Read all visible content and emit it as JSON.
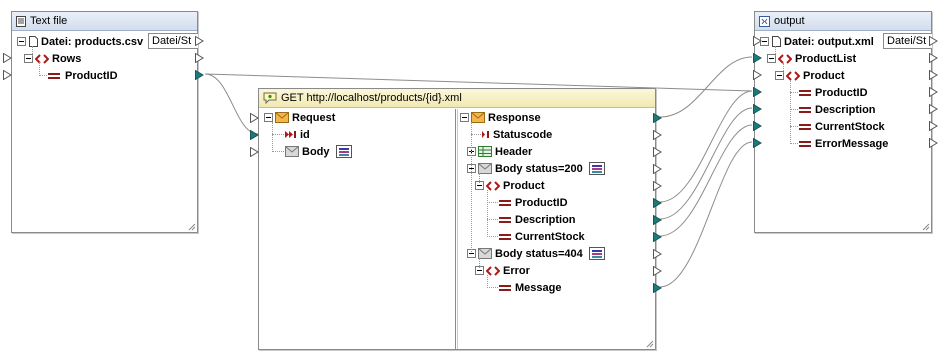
{
  "textfile": {
    "title": "Text file",
    "file_label": "Datei: products.csv",
    "dropdown": "Datei/St",
    "rows_label": "Rows",
    "productid_label": "ProductID"
  },
  "rest": {
    "title": "GET http://localhost/products/{id}.xml",
    "request_label": "Request",
    "id_label": "id",
    "body_label": "Body",
    "response_label": "Response",
    "statuscode_label": "Statuscode",
    "header_label": "Header",
    "body200_label": "Body status=200",
    "product_label": "Product",
    "productid_label": "ProductID",
    "description_label": "Description",
    "currentstock_label": "CurrentStock",
    "body404_label": "Body status=404",
    "error_label": "Error",
    "message_label": "Message"
  },
  "output": {
    "title": "output",
    "file_label": "Datei: output.xml",
    "dropdown": "Datei/St",
    "productlist_label": "ProductList",
    "product_label": "Product",
    "productid_label": "ProductID",
    "description_label": "Description",
    "currentstock_label": "CurrentStock",
    "errormessage_label": "ErrorMessage"
  },
  "colors": {
    "connector_filled": "#1b7a7a",
    "mapping_line": "#8c8c8c",
    "title_bar": "#dbe5f1",
    "rest_title_bar": "#f5efc4"
  }
}
